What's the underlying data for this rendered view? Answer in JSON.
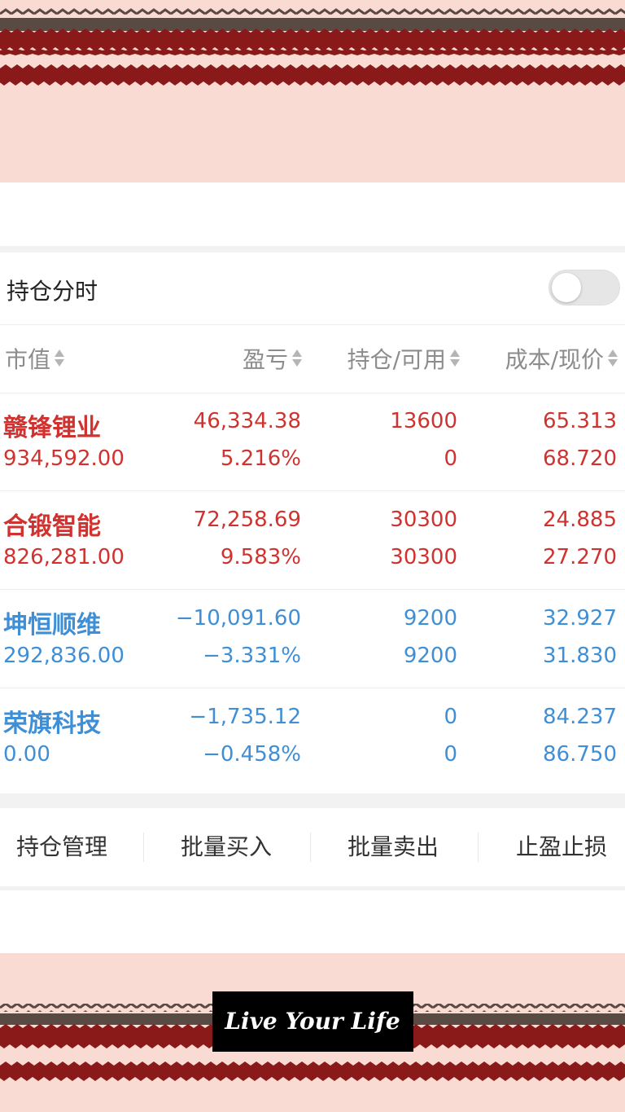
{
  "theme": {
    "up_color": "#d0332f",
    "down_color": "#3f8fd6",
    "banner_pink": "#fadbd3",
    "banner_red": "#8a1a1a",
    "banner_brown": "#5a4a44"
  },
  "holding_section": {
    "title": "持仓分时",
    "toggle_on": false
  },
  "columns": [
    "市值",
    "盈亏",
    "持仓/可用",
    "成本/现价"
  ],
  "holdings": [
    {
      "name": "赣锋锂业",
      "market_value": "934,592.00",
      "pnl": "46,334.38",
      "pnl_pct": "5.216%",
      "position": "13600",
      "available": "0",
      "cost": "65.313",
      "price": "68.720",
      "trend": "up"
    },
    {
      "name": "合锻智能",
      "market_value": "826,281.00",
      "pnl": "72,258.69",
      "pnl_pct": "9.583%",
      "position": "30300",
      "available": "30300",
      "cost": "24.885",
      "price": "27.270",
      "trend": "up"
    },
    {
      "name": "坤恒顺维",
      "market_value": "292,836.00",
      "pnl": "−10,091.60",
      "pnl_pct": "−3.331%",
      "position": "9200",
      "available": "9200",
      "cost": "32.927",
      "price": "31.830",
      "trend": "down"
    },
    {
      "name": "荣旗科技",
      "market_value": "0.00",
      "pnl": "−1,735.12",
      "pnl_pct": "−0.458%",
      "position": "0",
      "available": "0",
      "cost": "84.237",
      "price": "86.750",
      "trend": "down"
    }
  ],
  "actions": [
    "持仓管理",
    "批量买入",
    "批量卖出",
    "止盈止损"
  ],
  "decoration": {
    "logo_text": "Live Your Life"
  }
}
